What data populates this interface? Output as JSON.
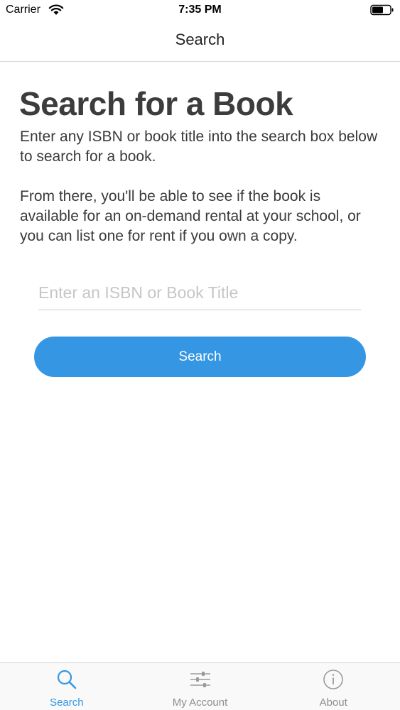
{
  "status_bar": {
    "carrier": "Carrier",
    "time": "7:35 PM",
    "wifi_icon": "wifi-icon",
    "battery_icon": "battery-icon"
  },
  "nav": {
    "title": "Search"
  },
  "main": {
    "heading": "Search for a Book",
    "paragraph_1": "Enter any ISBN or book title into the search box below to search for a book.",
    "paragraph_2": "From there, you'll be able to see if the book is available for an on-demand rental at your school, or you can list one for rent if you own a copy.",
    "search_input": {
      "value": "",
      "placeholder": "Enter an ISBN or Book Title"
    },
    "search_button_label": "Search"
  },
  "tab_bar": {
    "tabs": [
      {
        "label": "Search",
        "icon": "search-icon",
        "active": true
      },
      {
        "label": "My Account",
        "icon": "sliders-icon",
        "active": false
      },
      {
        "label": "About",
        "icon": "info-icon",
        "active": false
      }
    ]
  },
  "colors": {
    "accent": "#3597e3",
    "heading": "#3c3c3c",
    "inactive_tab": "#8e8e8e",
    "placeholder": "#c6c6c6"
  }
}
